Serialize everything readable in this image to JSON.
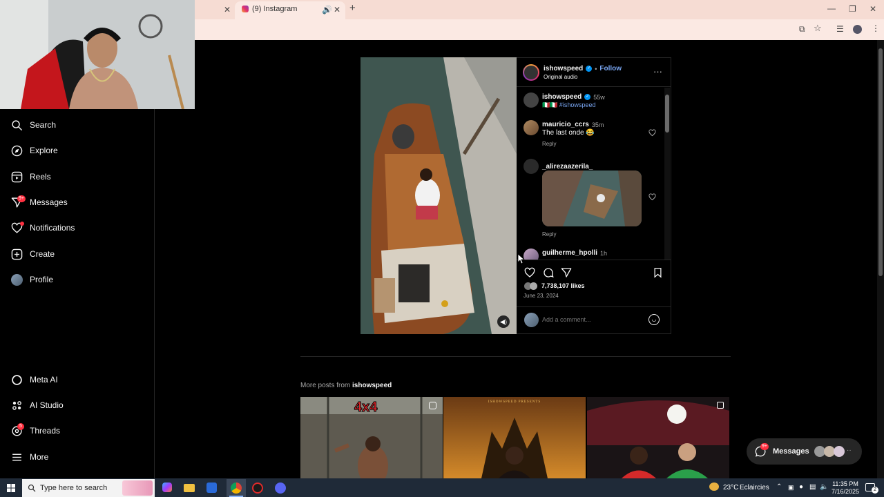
{
  "browser": {
    "tab_title": "(9) Instagram"
  },
  "sidebar": {
    "items": [
      {
        "label": "Search",
        "icon": "search-icon"
      },
      {
        "label": "Explore",
        "icon": "compass-icon"
      },
      {
        "label": "Reels",
        "icon": "reels-icon"
      },
      {
        "label": "Messages",
        "icon": "send-icon",
        "badge": "9+"
      },
      {
        "label": "Notifications",
        "icon": "heart-icon"
      },
      {
        "label": "Create",
        "icon": "plus-square-icon"
      },
      {
        "label": "Profile",
        "icon": "avatar"
      }
    ],
    "bottom_items": [
      {
        "label": "Meta AI",
        "icon": "meta-ai-icon"
      },
      {
        "label": "AI Studio",
        "icon": "ai-studio-icon"
      },
      {
        "label": "Threads",
        "icon": "threads-icon",
        "badge": "5"
      },
      {
        "label": "More",
        "icon": "menu-icon"
      }
    ]
  },
  "post": {
    "header": {
      "username": "ishowspeed",
      "separator": "•",
      "follow_label": "Follow",
      "audio": "Original audio"
    },
    "caption": {
      "username": "ishowspeed",
      "time": "55w",
      "text": "🇮🇹🇮🇹 #ishowspeed"
    },
    "comments": [
      {
        "username": "mauricio_ccrs",
        "time": "35m",
        "text": "The last onde 😂",
        "reply": "Reply"
      },
      {
        "username": "_alirezaazerila_",
        "time": "",
        "text": "",
        "reply": "Reply"
      },
      {
        "username": "guilherme_hpolli",
        "time": "1h",
        "text": ""
      }
    ],
    "likes": "7,738,107 likes",
    "date": "June 23, 2024",
    "comment_placeholder": "Add a comment..."
  },
  "more_posts": {
    "prefix": "More posts from ",
    "username": "ishowspeed",
    "thumb1_text": "4x4",
    "thumb2_text": "ISHOWSPEED PRESENTS"
  },
  "messages_pill": {
    "label": "Messages",
    "badge": "9+"
  },
  "taskbar": {
    "search_placeholder": "Type here to search",
    "weather_temp": "23°C",
    "weather_desc": "Eclaircies",
    "time": "11:35 PM",
    "date": "7/16/2025",
    "notif_count": "2"
  },
  "colors": {
    "accent_blue": "#0095f6",
    "link_blue": "#79a6f2",
    "badge_red": "#ff3040",
    "verified_blue": "#0095f6"
  }
}
